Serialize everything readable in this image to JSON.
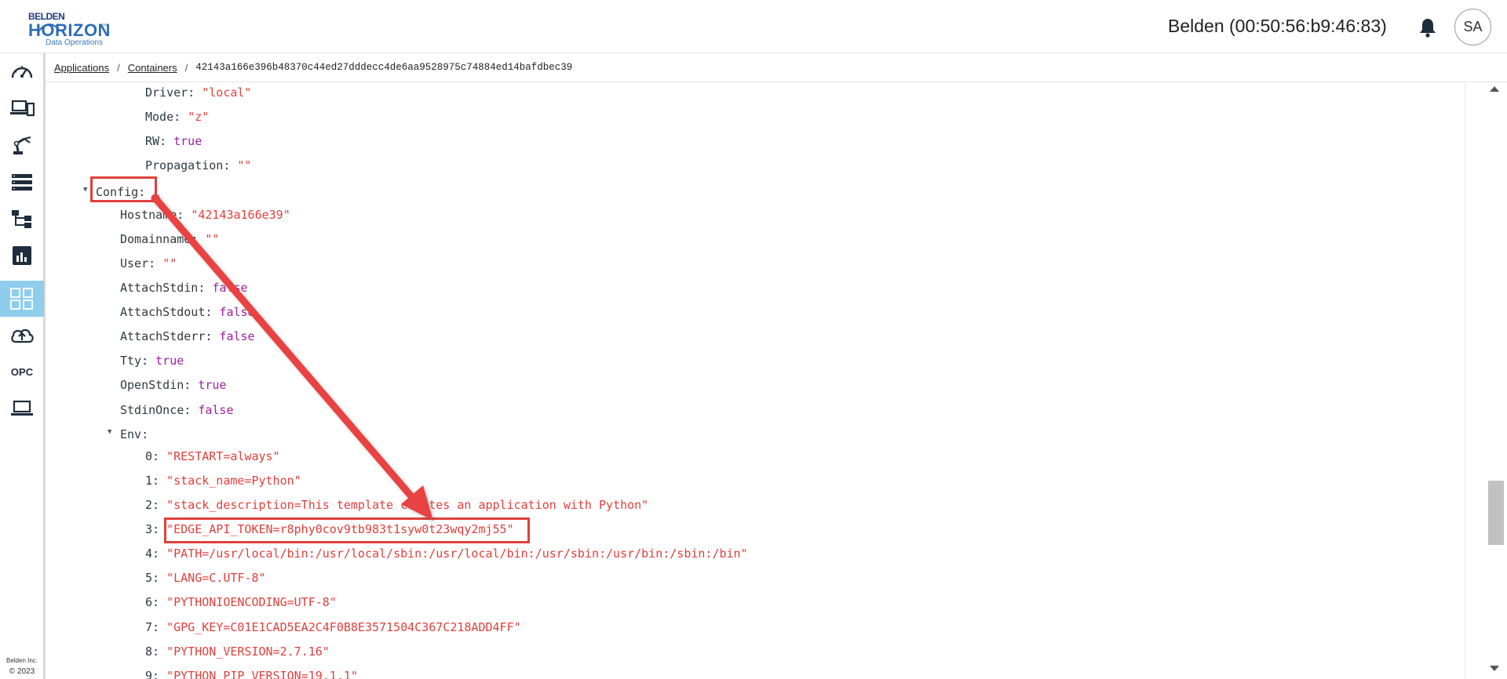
{
  "header": {
    "logo": {
      "brand": "BELDEN",
      "name": "HORIZON",
      "tm": "™",
      "sub": "Data Operations"
    },
    "device_title": "Belden (00:50:56:b9:46:83)",
    "avatar_initials": "SA",
    "icons": {
      "bell": "bell-icon"
    }
  },
  "sidebar": {
    "items": [
      {
        "icon": "dashboard-gauge-icon"
      },
      {
        "icon": "devices-icon"
      },
      {
        "icon": "robot-arm-icon"
      },
      {
        "icon": "list-icon"
      },
      {
        "icon": "hierarchy-icon"
      },
      {
        "icon": "analytics-icon"
      },
      {
        "icon": "applications-grid-icon",
        "active": true
      },
      {
        "icon": "cloud-upload-icon"
      },
      {
        "label": "OPC"
      },
      {
        "icon": "laptop-icon"
      }
    ],
    "footer": {
      "company": "Belden Inc.",
      "year": "© 2023"
    },
    "active_color": "#8fcdec"
  },
  "breadcrumb": {
    "items": [
      "Applications",
      "Containers"
    ],
    "separator": "/",
    "current": "42143a166e396b48370c44ed27dddecc4de6aa9528975c74884ed14bafdbec39"
  },
  "viewer": {
    "mount_fields": [
      {
        "key": "Driver",
        "value": "\"local\"",
        "type": "string"
      },
      {
        "key": "Mode",
        "value": "\"z\"",
        "type": "string"
      },
      {
        "key": "RW",
        "value": "true",
        "type": "bool"
      },
      {
        "key": "Propagation",
        "value": "\"\"",
        "type": "string"
      }
    ],
    "config_key": "Config",
    "config_fields": [
      {
        "key": "Hostname",
        "value": "\"42143a166e39\"",
        "type": "string"
      },
      {
        "key": "Domainname",
        "value": "\"\"",
        "type": "string"
      },
      {
        "key": "User",
        "value": "\"\"",
        "type": "string"
      },
      {
        "key": "AttachStdin",
        "value": "false",
        "type": "bool"
      },
      {
        "key": "AttachStdout",
        "value": "false",
        "type": "bool"
      },
      {
        "key": "AttachStderr",
        "value": "false",
        "type": "bool"
      },
      {
        "key": "Tty",
        "value": "true",
        "type": "bool"
      },
      {
        "key": "OpenStdin",
        "value": "true",
        "type": "bool"
      },
      {
        "key": "StdinOnce",
        "value": "false",
        "type": "bool"
      }
    ],
    "env_key": "Env",
    "env": [
      "\"RESTART=always\"",
      "\"stack_name=Python\"",
      "\"stack_description=This template creates an application with Python\"",
      "\"EDGE_API_TOKEN=r8phy0cov9tb983t1syw0t23wqy2mj55\"",
      "\"PATH=/usr/local/bin:/usr/local/sbin:/usr/local/bin:/usr/sbin:/usr/bin:/sbin:/bin\"",
      "\"LANG=C.UTF-8\"",
      "\"PYTHONIOENCODING=UTF-8\"",
      "\"GPG_KEY=C01E1CAD5EA2C4F0B8E3571504C367C218ADD4FF\"",
      "\"PYTHON_VERSION=2.7.16\"",
      "\"PYTHON_PIP_VERSION=19.1.1\""
    ],
    "highlighted_env_index": 3,
    "annotation_color": "#e0403c"
  }
}
